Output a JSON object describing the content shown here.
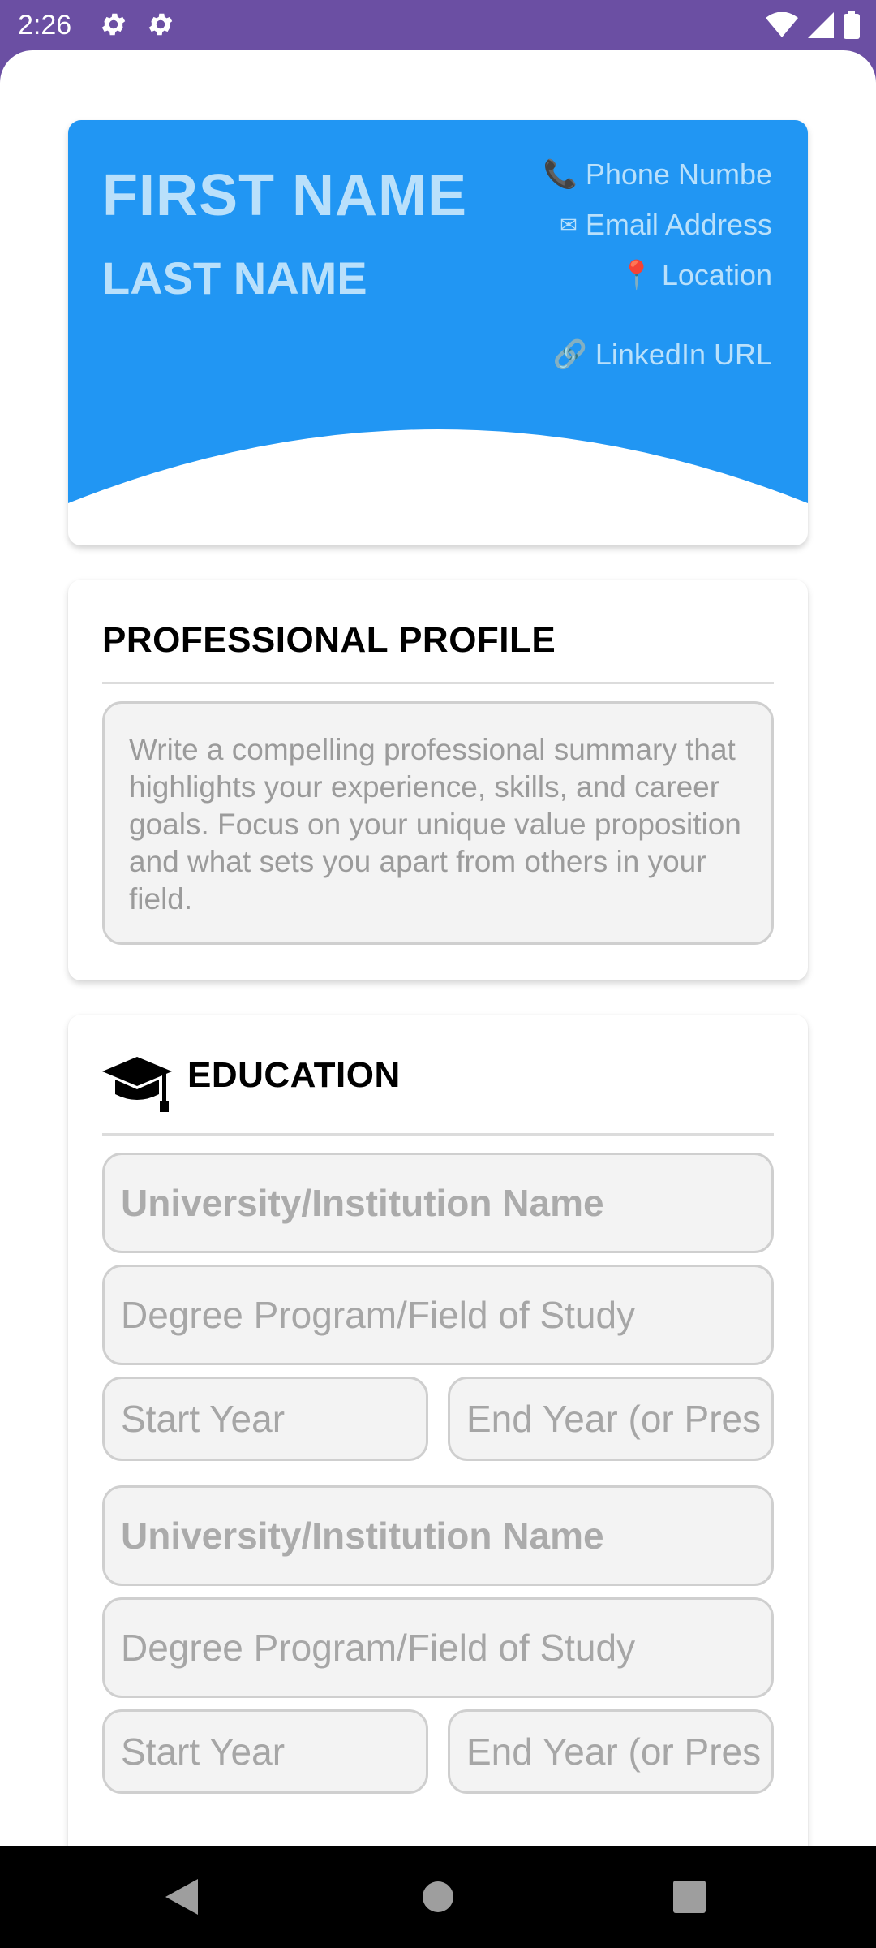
{
  "status_bar": {
    "time": "2:26",
    "icons": [
      "gear-icon",
      "gear-icon",
      "wifi-icon",
      "signal-icon",
      "battery-icon"
    ]
  },
  "header": {
    "first_name": "FIRST NAME",
    "last_name": "LAST NAME",
    "phone": "Phone Numbe",
    "email": "Email Address",
    "location": "Location",
    "linkedin": "LinkedIn URL",
    "accent_color": "#2196f3",
    "text_color": "#b9e0fb"
  },
  "profile": {
    "title": "PROFESSIONAL PROFILE",
    "summary_placeholder": "Write a compelling professional summary that highlights your experience, skills, and career goals. Focus on your unique value proposition and what sets you apart from others in your field."
  },
  "education": {
    "title": "EDUCATION",
    "entries": [
      {
        "institution_placeholder": "University/Institution Name",
        "degree_placeholder": "Degree Program/Field of Study",
        "start_placeholder": "Start Year",
        "end_placeholder": "End Year (or Pres"
      },
      {
        "institution_placeholder": "University/Institution Name",
        "degree_placeholder": "Degree Program/Field of Study",
        "start_placeholder": "Start Year",
        "end_placeholder": "End Year (or Pres"
      }
    ]
  },
  "nav": {
    "buttons": [
      "back-icon",
      "home-icon",
      "recents-icon"
    ]
  }
}
